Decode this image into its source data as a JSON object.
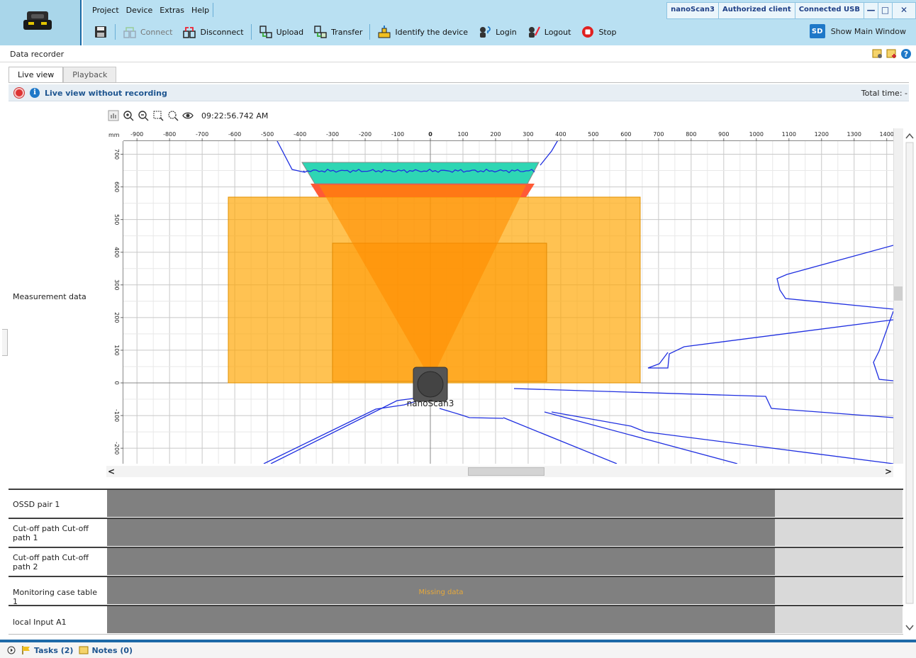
{
  "menu": [
    "Project",
    "Device",
    "Extras",
    "Help"
  ],
  "status": {
    "device": "nanoScan3",
    "client": "Authorized client",
    "connection": "Connected USB"
  },
  "window_buttons": [
    "—",
    "□",
    "✕"
  ],
  "toolbar": {
    "connect": "Connect",
    "disconnect": "Disconnect",
    "upload": "Upload",
    "transfer": "Transfer",
    "identify": "Identify the device",
    "login": "Login",
    "logout": "Logout",
    "stop": "Stop",
    "show_main": "Show Main Window",
    "sd_badge": "SD"
  },
  "panel_title": "Data recorder",
  "tabs": [
    {
      "label": "Live view",
      "active": true
    },
    {
      "label": "Playback",
      "active": false
    }
  ],
  "live": {
    "label": "Live view without recording",
    "total_time": "Total time: -"
  },
  "measurement": {
    "label": "Measurement data",
    "timestamp": "09:22:56.742 AM",
    "unit": "mm",
    "x_ticks": [
      -900,
      -800,
      -700,
      -600,
      -500,
      -400,
      -300,
      -200,
      -100,
      0,
      100,
      200,
      300,
      400,
      500,
      600,
      700,
      800,
      900,
      1000,
      1100,
      1200,
      1300,
      1400
    ],
    "y_ticks": [
      700,
      600,
      500,
      400,
      300,
      200,
      100,
      0,
      -100,
      -200
    ],
    "device_label": "nanoScan3"
  },
  "rows": [
    {
      "label": "OSSD pair 1"
    },
    {
      "label": "Cut-off path Cut-off path 1"
    },
    {
      "label": "Cut-off path Cut-off path 2"
    },
    {
      "label": "Monitoring case table 1",
      "note": "Missing data"
    },
    {
      "label": "local Input A1"
    }
  ],
  "bottom": {
    "tasks": "Tasks (2)",
    "notes": "Notes (0)"
  },
  "colors": {
    "header": "#b9e0f2",
    "accent": "#1e6aa8",
    "warning_field": "#ffa500",
    "protective_field": "#ff5a36",
    "reference": "#2ed6b4",
    "scan": "#1f2fe0",
    "signal": "#808080"
  }
}
